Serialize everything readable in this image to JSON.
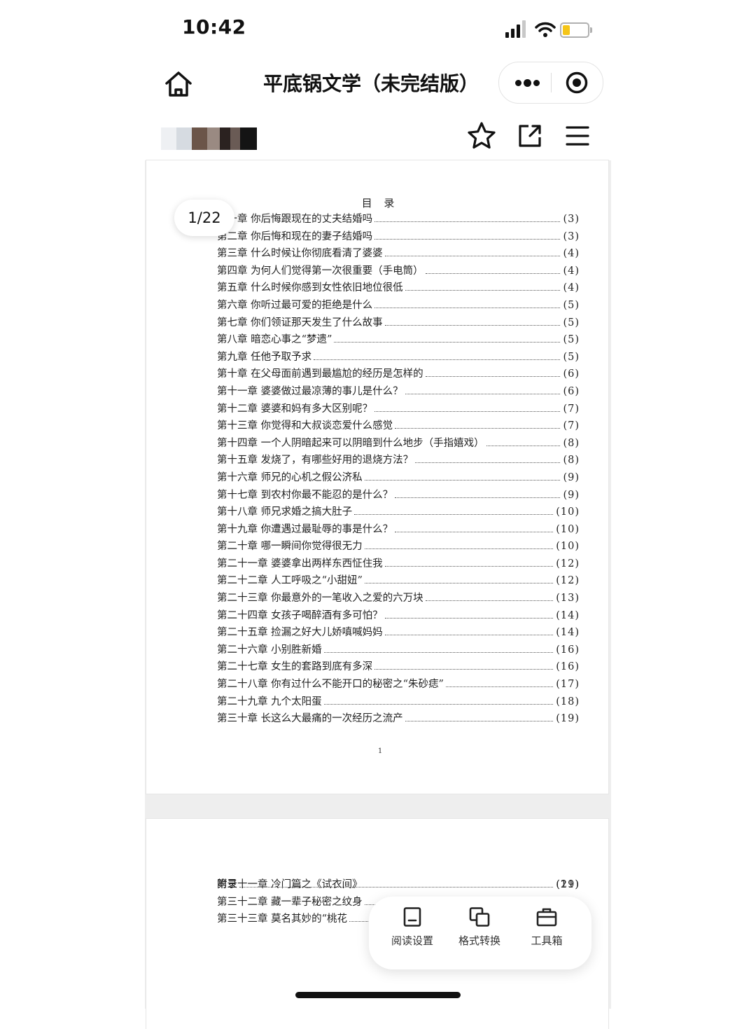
{
  "status_bar": {
    "time": "10:42"
  },
  "nav": {
    "title": "平底锅文学（未完结版）"
  },
  "page_indicator": {
    "label": "1/22"
  },
  "document": {
    "toc_title": "目 录",
    "page1_entries": [
      {
        "title": "第一章 你后悔跟现在的丈夫结婚吗",
        "page": "(3)"
      },
      {
        "title": "第二章 你后悔和现在的妻子结婚吗",
        "page": "(3)"
      },
      {
        "title": "第三章 什么时候让你彻底看清了婆婆",
        "page": "(4)"
      },
      {
        "title": "第四章 为何人们觉得第一次很重要（手电筒）",
        "page": "(4)"
      },
      {
        "title": "第五章 什么时候你感到女性依旧地位很低",
        "page": "(4)"
      },
      {
        "title": "第六章 你听过最可爱的拒绝是什么",
        "page": "(5)"
      },
      {
        "title": "第七章 你们领证那天发生了什么故事",
        "page": "(5)"
      },
      {
        "title": "第八章 暗恋心事之“梦遗”",
        "page": "(5)"
      },
      {
        "title": "第九章 任他予取予求",
        "page": "(5)"
      },
      {
        "title": "第十章 在父母面前遇到最尴尬的经历是怎样的",
        "page": "(6)"
      },
      {
        "title": "第十一章 婆婆做过最凉薄的事儿是什么？",
        "page": "(6)"
      },
      {
        "title": "第十二章 婆婆和妈有多大区别呢？",
        "page": "(7)"
      },
      {
        "title": "第十三章 你觉得和大叔谈恋爱什么感觉",
        "page": "(7)"
      },
      {
        "title": "第十四章 一个人阴暗起来可以阴暗到什么地步（手指嬉戏）",
        "page": "(8)"
      },
      {
        "title": "第十五章 发烧了，有哪些好用的退烧方法？",
        "page": "(8)"
      },
      {
        "title": "第十六章 师兄的心机之假公济私",
        "page": "(9)"
      },
      {
        "title": "第十七章 到农村你最不能忍的是什么？",
        "page": "(9)"
      },
      {
        "title": "第十八章 师兄求婚之搞大肚子",
        "page": "(10)"
      },
      {
        "title": "第十九章 你遭遇过最耻辱的事是什么？",
        "page": "(10)"
      },
      {
        "title": "第二十章 哪一瞬间你觉得很无力",
        "page": "(10)"
      },
      {
        "title": "第二十一章 婆婆拿出两样东西怔住我",
        "page": "(12)"
      },
      {
        "title": "第二十二章 人工呼吸之“小甜妞”",
        "page": "(12)"
      },
      {
        "title": "第二十三章 你最意外的一笔收入之爱的六万块",
        "page": "(13)"
      },
      {
        "title": "第二十四章 女孩子喝醉酒有多可怕？",
        "page": "(14)"
      },
      {
        "title": "第二十五章 捡漏之好大儿娇嗔喊妈妈",
        "page": "(14)"
      },
      {
        "title": "第二十六章 小别胜新婚",
        "page": "(16)"
      },
      {
        "title": "第二十七章 女生的套路到底有多深",
        "page": "(16)"
      },
      {
        "title": "第二十八章 你有过什么不能开口的秘密之“朱砂痣”",
        "page": "(17)"
      },
      {
        "title": "第二十九章 九个太阳蛋",
        "page": "(18)"
      },
      {
        "title": "第三十章 长这么大最痛的一次经历之流产",
        "page": "(19)"
      }
    ],
    "page1_number": "1",
    "page2_entries": [
      {
        "title": "第三十一章 冷门篇之《试衣间》",
        "page": "(19)"
      },
      {
        "title": "第三十二章 藏一辈子秘密之纹身",
        "page": ""
      },
      {
        "title": "第三十三章 莫名其妙的“桃花",
        "page": ""
      }
    ],
    "appendix": {
      "title": "附录",
      "page": "(21)"
    }
  },
  "floating_tools": [
    {
      "label": "阅读设置",
      "icon": "reading-settings-icon"
    },
    {
      "label": "格式转换",
      "icon": "format-convert-icon"
    },
    {
      "label": "工具箱",
      "icon": "toolbox-icon"
    }
  ],
  "colors": {
    "battery": "#f5c518",
    "text": "#111111",
    "page_bg": "#eeeeee"
  }
}
